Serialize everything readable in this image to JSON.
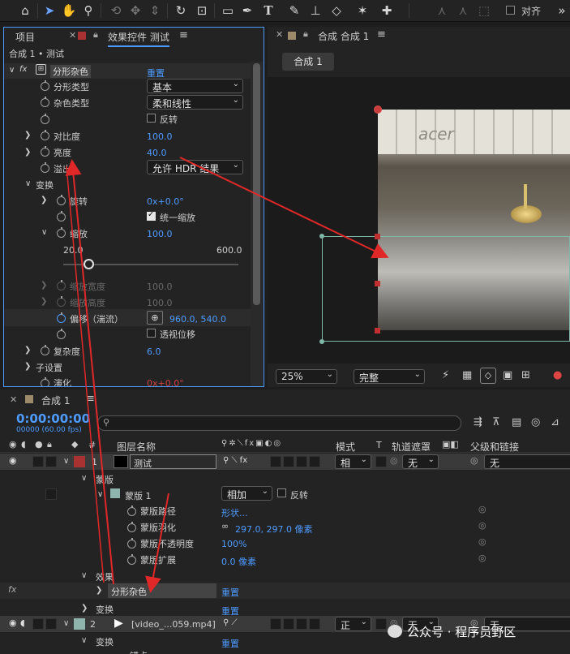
{
  "toolbar": {
    "align_label": "对齐"
  },
  "left_panel": {
    "tab_project": "项目",
    "tab_effects": "效果控件 测试",
    "breadcrumb": "合成 1 • 测试",
    "effect": {
      "name": "分形杂色",
      "reset": "重置"
    },
    "props": {
      "fractal_type": {
        "label": "分形类型",
        "value": "基本"
      },
      "noise_type": {
        "label": "杂色类型",
        "value": "柔和线性"
      },
      "invert": {
        "label": "反转"
      },
      "contrast": {
        "label": "对比度",
        "value": "100.0"
      },
      "brightness": {
        "label": "亮度",
        "value": "40.0"
      },
      "overflow": {
        "label": "溢出",
        "value": "允许 HDR 结果"
      },
      "transform": {
        "label": "变换"
      },
      "rotation": {
        "label": "旋转",
        "value": "0x+0.0°"
      },
      "uniform_scale": {
        "label": "统一缩放"
      },
      "scale": {
        "label": "缩放",
        "value": "100.0",
        "slider_min": "20.0",
        "slider_max": "600.0",
        "slider_fraction": 0.143
      },
      "scale_width": {
        "label": "缩放宽度",
        "value": "100.0"
      },
      "scale_height": {
        "label": "缩放高度",
        "value": "100.0"
      },
      "offset": {
        "label": "偏移（湍流）",
        "value": "960.0, 540.0"
      },
      "perspective": {
        "label": "透视位移"
      },
      "complexity": {
        "label": "复杂度",
        "value": "6.0"
      },
      "sub_settings": {
        "label": "子设置"
      },
      "evolution": {
        "label": "演化",
        "value": "0x+0.0°"
      }
    }
  },
  "viewer": {
    "tab": "合成 合成 1",
    "comp_button": "合成 1",
    "zoom": "25%",
    "quality": "完整",
    "image_text": "acer"
  },
  "timeline": {
    "tab": "合成 1",
    "timecode": "0:00:00:00",
    "frame_info": "00000 (60.00 fps)",
    "col_number": "#",
    "col_layer_name": "图层名称",
    "col_mode": "模式",
    "col_t": "T",
    "col_track_matte": "轨道遮罩",
    "col_parent": "父级和链接",
    "layer1": {
      "num": "1",
      "name": "测试",
      "mode": "相",
      "matte": "无",
      "parent": "无"
    },
    "masks": "蒙版",
    "mask1": {
      "name": "蒙版 1",
      "mode": "相加",
      "invert": "反转"
    },
    "mask_path": {
      "label": "蒙版路径",
      "value": "形状..."
    },
    "mask_feather": {
      "label": "蒙版羽化",
      "value": "297.0, 297.0 像素"
    },
    "mask_opacity": {
      "label": "蒙版不透明度",
      "value": "100%"
    },
    "mask_expansion": {
      "label": "蒙版扩展",
      "value": "0.0 像素"
    },
    "effects": "效果",
    "fx_label": "fx",
    "effect_item": {
      "name": "分形杂色",
      "reset": "重置"
    },
    "transform": {
      "label": "变换",
      "reset": "重置"
    },
    "layer2": {
      "num": "2",
      "name": "[video_...059.mp4]",
      "mode": "正",
      "matte": "无",
      "parent": "无"
    },
    "transform2": {
      "label": "变换",
      "reset": "重置"
    },
    "anchor_partial": "锚点"
  },
  "watermark": "公众号 · 程序员野区",
  "colors": {
    "accent": "#4d9bff",
    "layer1_label": "#a83232",
    "layer2_label": "#8fb3ad"
  }
}
